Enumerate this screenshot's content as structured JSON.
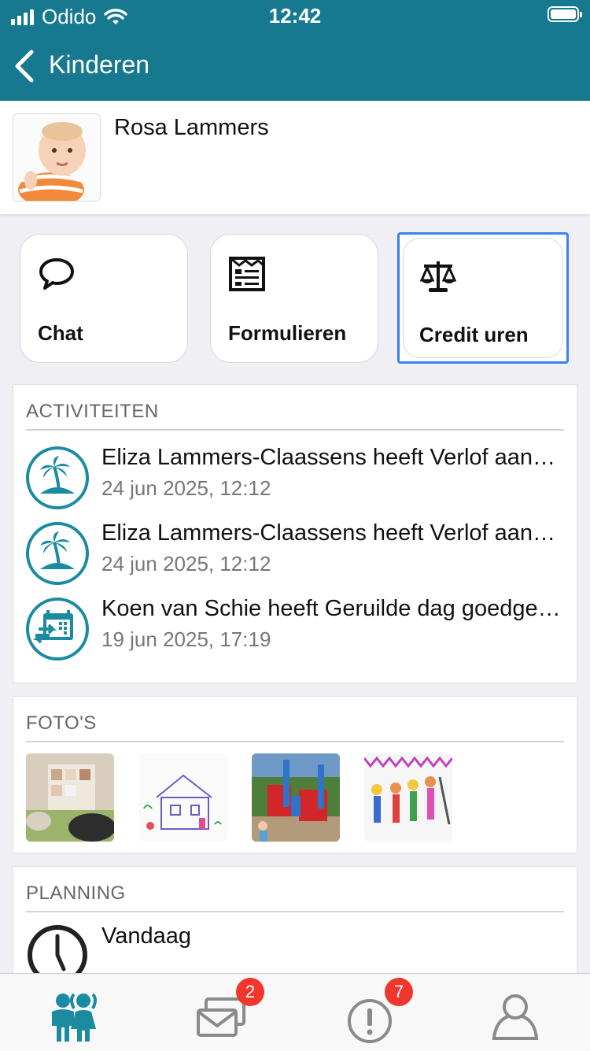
{
  "status": {
    "carrier": "Odido",
    "time": "12:42"
  },
  "nav": {
    "title": "Kinderen"
  },
  "profile": {
    "name": "Rosa Lammers"
  },
  "tiles": [
    {
      "label": "Chat",
      "icon": "chat-bubble-icon"
    },
    {
      "label": "Formulieren",
      "icon": "form-icon"
    },
    {
      "label": "Credit uren",
      "icon": "scale-icon"
    }
  ],
  "activities": {
    "title": "ACTIVITEITEN",
    "items": [
      {
        "title": "Eliza Lammers-Claassens heeft Verlof aangevraagd",
        "date": "24 jun 2025, 12:12",
        "icon": "palm-island-icon"
      },
      {
        "title": "Eliza Lammers-Claassens heeft Verlof aangevraagd",
        "date": "24 jun 2025, 12:12",
        "icon": "palm-island-icon"
      },
      {
        "title": "Koen van Schie heeft Geruilde dag goedgekeurd",
        "date": "19 jun 2025, 17:19",
        "icon": "calendar-swap-icon"
      }
    ]
  },
  "photos": {
    "title": "FOTO'S"
  },
  "planning": {
    "title": "PLANNING",
    "item": "Vandaag"
  },
  "tabbar": {
    "tabs": [
      {
        "name": "children",
        "icon": "children-icon",
        "active": true
      },
      {
        "name": "messages",
        "icon": "messages-icon",
        "badge": "2"
      },
      {
        "name": "notifications",
        "icon": "alert-icon",
        "badge": "7"
      },
      {
        "name": "profile",
        "icon": "person-icon"
      }
    ]
  },
  "colors": {
    "brand": "#16798f",
    "accent_icon": "#1b8ba2",
    "badge": "#f0362e",
    "focus": "#3b82f0"
  }
}
